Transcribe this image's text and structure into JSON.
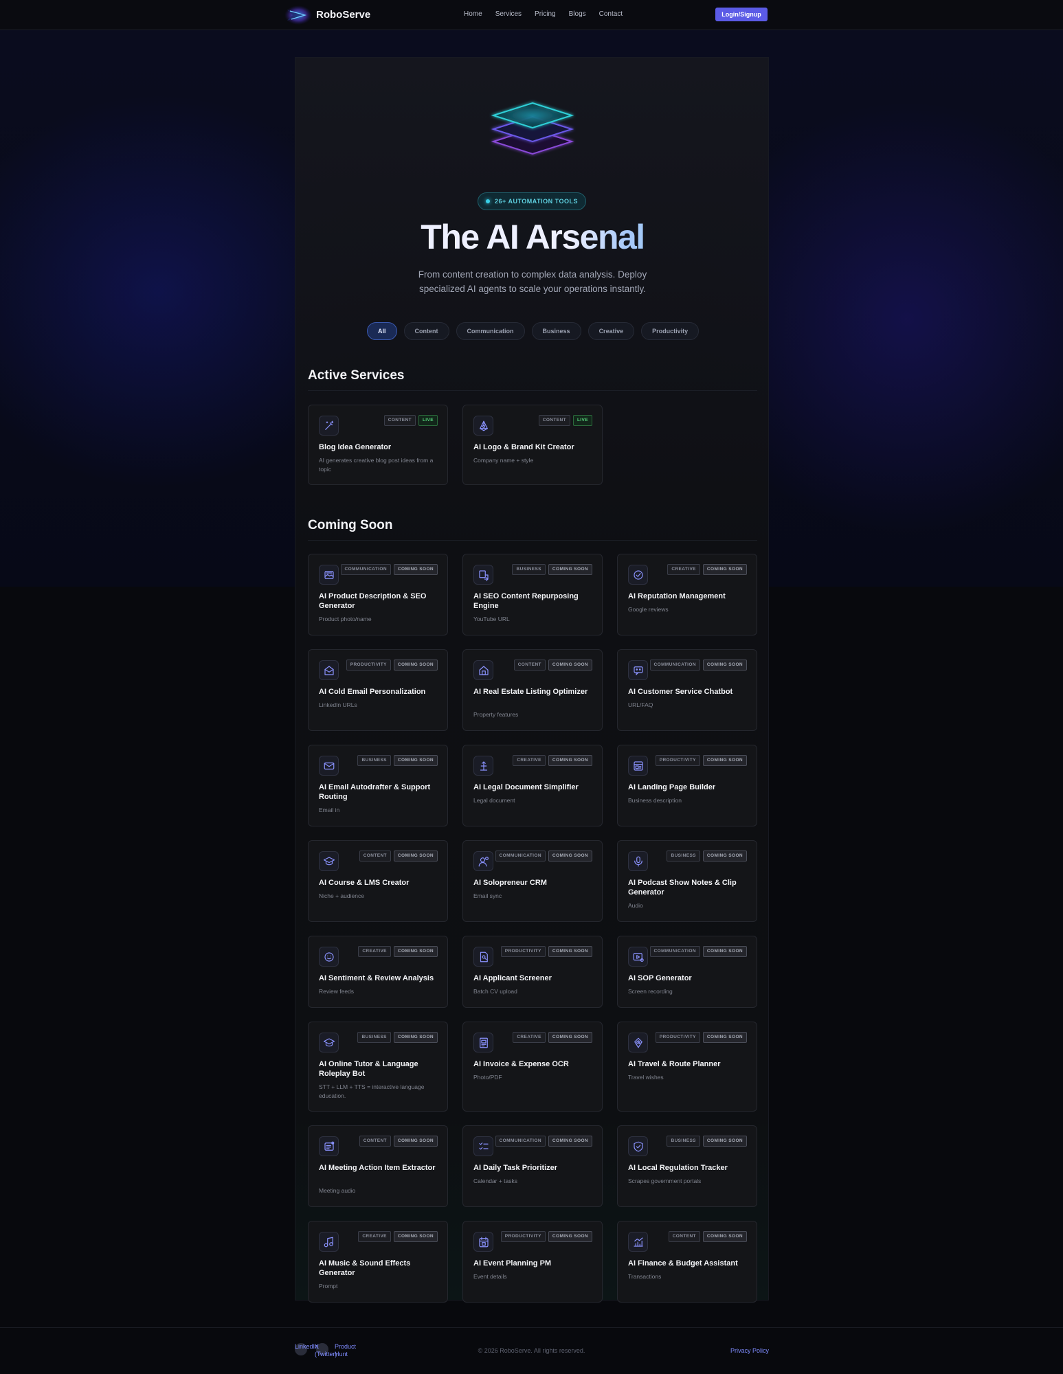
{
  "brand": "RoboServe",
  "nav": {
    "links": [
      "Home",
      "Services",
      "Pricing",
      "Blogs",
      "Contact"
    ],
    "login": "Login/Signup"
  },
  "hero": {
    "badge": "26+ AUTOMATION TOOLS",
    "title": "The AI Arsenal",
    "subtitle": "From content creation to complex data analysis. Deploy specialized AI agents to scale your operations instantly."
  },
  "filters": [
    "All",
    "Content",
    "Communication",
    "Business",
    "Creative",
    "Productivity"
  ],
  "active_filter": "All",
  "active_section": {
    "title": "Active Services",
    "cards": [
      {
        "icon": "magic-wand-icon",
        "category": "CONTENT",
        "status": "LIVE",
        "title": "Blog Idea Generator",
        "desc": "AI generates creative blog post ideas from a topic"
      },
      {
        "icon": "pen-nib-icon",
        "category": "CONTENT",
        "status": "LIVE",
        "title": "AI Logo & Brand Kit Creator",
        "desc": "Company name + style"
      }
    ]
  },
  "soon_section": {
    "title": "Coming Soon",
    "cards": [
      {
        "icon": "image-icon",
        "category": "COMMUNICATION",
        "status": "COMING SOON",
        "title": "AI Product Description & SEO Generator",
        "desc": "Product photo/name"
      },
      {
        "icon": "repurpose-icon",
        "category": "BUSINESS",
        "status": "COMING SOON",
        "title": "AI SEO Content Repurposing Engine",
        "desc": "YouTube URL"
      },
      {
        "icon": "badge-check-icon",
        "category": "CREATIVE",
        "status": "COMING SOON",
        "title": "AI Reputation Management",
        "desc": "Google reviews"
      },
      {
        "icon": "mail-open-icon",
        "category": "PRODUCTIVITY",
        "status": "COMING SOON",
        "title": "AI Cold Email Personalization",
        "desc": "LinkedIn URLs"
      },
      {
        "icon": "house-icon",
        "category": "CONTENT",
        "status": "COMING SOON",
        "title": "AI Real Estate Listing Optimizer",
        "desc": "Property features"
      },
      {
        "icon": "chat-bot-icon",
        "category": "COMMUNICATION",
        "status": "COMING SOON",
        "title": "AI Customer Service Chatbot",
        "desc": "URL/FAQ"
      },
      {
        "icon": "mail-icon",
        "category": "BUSINESS",
        "status": "COMING SOON",
        "title": "AI Email Autodrafter & Support Routing",
        "desc": "Email in"
      },
      {
        "icon": "legal-icon",
        "category": "CREATIVE",
        "status": "COMING SOON",
        "title": "AI Legal Document Simplifier",
        "desc": "Legal document"
      },
      {
        "icon": "layout-icon",
        "category": "PRODUCTIVITY",
        "status": "COMING SOON",
        "title": "AI Landing Page Builder",
        "desc": "Business description"
      },
      {
        "icon": "graduation-cap-icon",
        "category": "CONTENT",
        "status": "COMING SOON",
        "title": "AI Course & LMS Creator",
        "desc": "Niche + audience"
      },
      {
        "icon": "user-plus-icon",
        "category": "COMMUNICATION",
        "status": "COMING SOON",
        "title": "AI Solopreneur CRM",
        "desc": "Email sync"
      },
      {
        "icon": "microphone-icon",
        "category": "BUSINESS",
        "status": "COMING SOON",
        "title": "AI Podcast Show Notes & Clip Generator",
        "desc": "Audio"
      },
      {
        "icon": "smile-icon",
        "category": "CREATIVE",
        "status": "COMING SOON",
        "title": "AI Sentiment & Review Analysis",
        "desc": "Review feeds"
      },
      {
        "icon": "document-search-icon",
        "category": "PRODUCTIVITY",
        "status": "COMING SOON",
        "title": "AI Applicant Screener",
        "desc": "Batch CV upload"
      },
      {
        "icon": "video-record-icon",
        "category": "COMMUNICATION",
        "status": "COMING SOON",
        "title": "AI SOP Generator",
        "desc": "Screen recording"
      },
      {
        "icon": "graduation-cap-icon",
        "category": "BUSINESS",
        "status": "COMING SOON",
        "title": "AI Online Tutor & Language Roleplay Bot",
        "desc": "STT + LLM + TTS = interactive language education."
      },
      {
        "icon": "receipt-icon",
        "category": "CREATIVE",
        "status": "COMING SOON",
        "title": "AI Invoice & Expense OCR",
        "desc": "Photo/PDF"
      },
      {
        "icon": "route-icon",
        "category": "PRODUCTIVITY",
        "status": "COMING SOON",
        "title": "AI Travel & Route Planner",
        "desc": "Travel wishes"
      },
      {
        "icon": "notes-icon",
        "category": "CONTENT",
        "status": "COMING SOON",
        "title": "AI Meeting Action Item Extractor",
        "desc": "Meeting audio"
      },
      {
        "icon": "checklist-icon",
        "category": "COMMUNICATION",
        "status": "COMING SOON",
        "title": "AI Daily Task Prioritizer",
        "desc": "Calendar + tasks"
      },
      {
        "icon": "shield-check-icon",
        "category": "BUSINESS",
        "status": "COMING SOON",
        "title": "AI Local Regulation Tracker",
        "desc": "Scrapes government portals"
      },
      {
        "icon": "music-icon",
        "category": "CREATIVE",
        "status": "COMING SOON",
        "title": "AI Music & Sound Effects Generator",
        "desc": "Prompt"
      },
      {
        "icon": "calendar-icon",
        "category": "PRODUCTIVITY",
        "status": "COMING SOON",
        "title": "AI Event Planning PM",
        "desc": "Event details"
      },
      {
        "icon": "chart-icon",
        "category": "CONTENT",
        "status": "COMING SOON",
        "title": "AI Finance & Budget Assistant",
        "desc": "Transactions"
      }
    ]
  },
  "footer": {
    "social": [
      "LinkedIn",
      "X (Twitter)",
      "Product Hunt"
    ],
    "copyright": "© 2026 RoboServe. All rights reserved.",
    "privacy": "Privacy Policy"
  },
  "colors": {
    "accent": "#5b5be6",
    "icon_stroke": "#8b93ff",
    "live": "#56d27a",
    "badge_text": "#5fd0e0"
  }
}
